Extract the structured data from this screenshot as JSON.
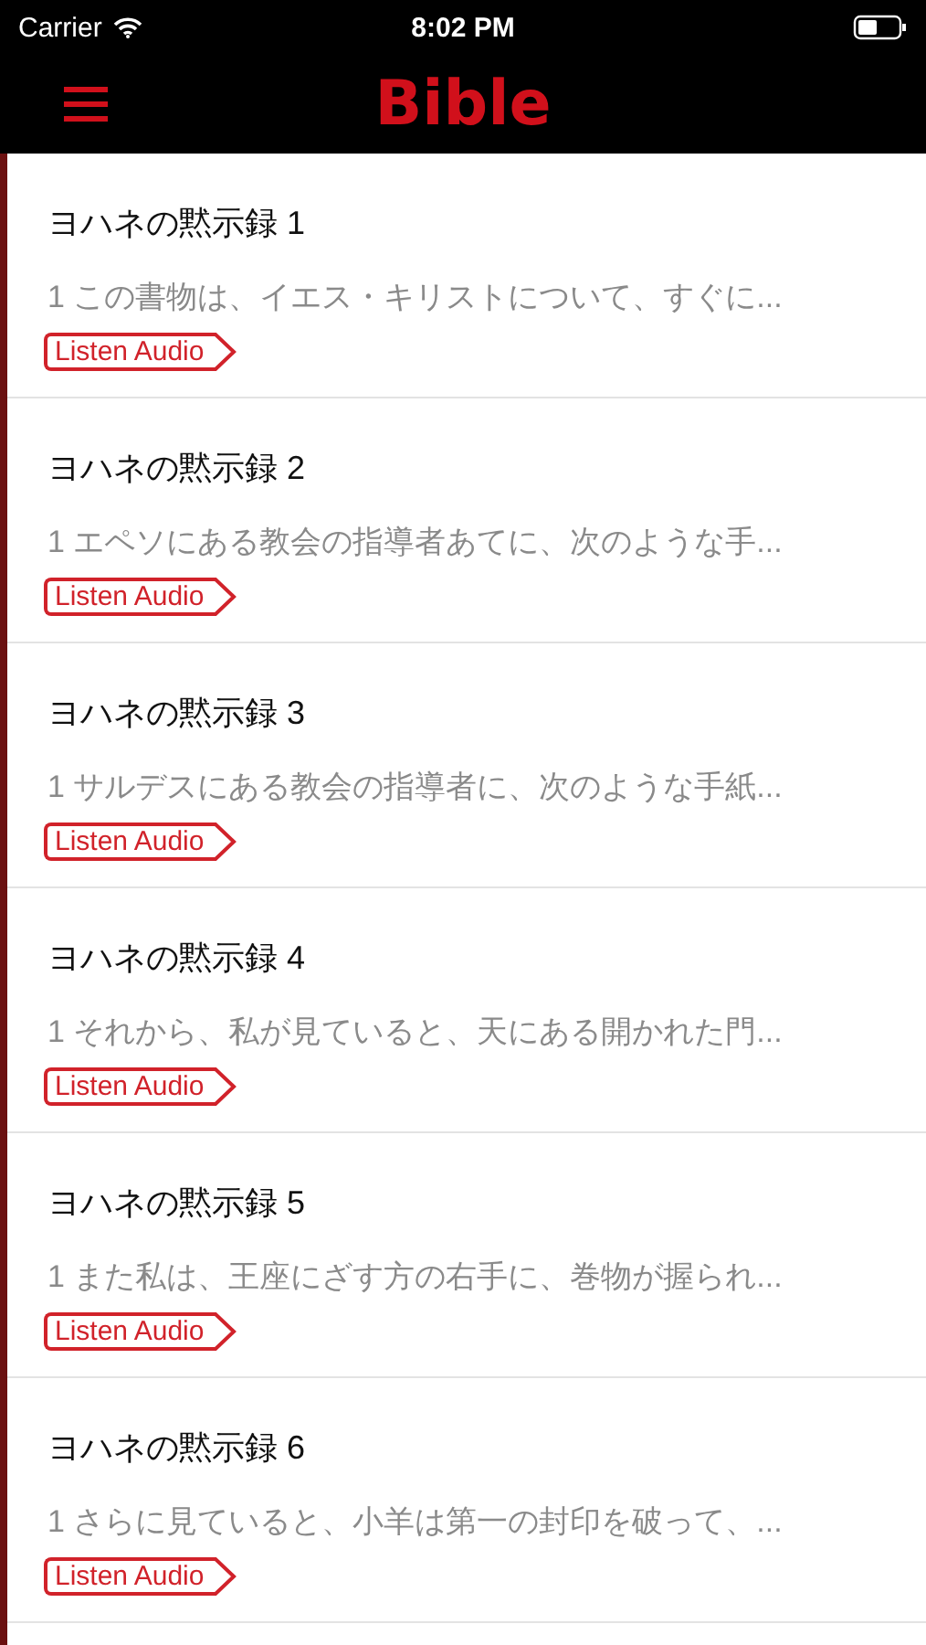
{
  "status_bar": {
    "carrier": "Carrier",
    "time": "8:02 PM"
  },
  "header": {
    "title": "Bible"
  },
  "chapters": [
    {
      "title": "ヨハネの黙示録 1",
      "preview": "1 この書物は、イエス・キリストについて、すぐに...",
      "audio_label": "Listen Audio"
    },
    {
      "title": "ヨハネの黙示録 2",
      "preview": "1 エペソにある教会の指導者あてに、次のような手...",
      "audio_label": "Listen Audio"
    },
    {
      "title": "ヨハネの黙示録 3",
      "preview": "1 サルデスにある教会の指導者に、次のような手紙...",
      "audio_label": "Listen Audio"
    },
    {
      "title": "ヨハネの黙示録 4",
      "preview": "1 それから、私が見ていると、天にある開かれた門...",
      "audio_label": "Listen Audio"
    },
    {
      "title": "ヨハネの黙示録 5",
      "preview": "1 また私は、王座にざす方の右手に、巻物が握られ...",
      "audio_label": "Listen Audio"
    },
    {
      "title": "ヨハネの黙示録 6",
      "preview": "1 さらに見ていると、小羊は第一の封印を破って、...",
      "audio_label": "Listen Audio"
    }
  ]
}
